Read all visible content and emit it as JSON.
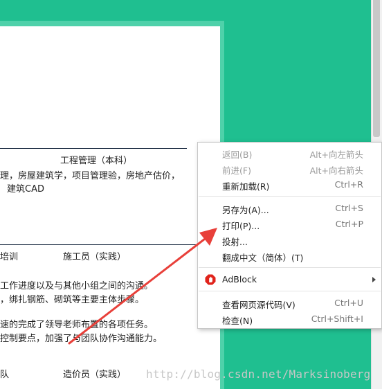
{
  "document": {
    "section_title": "工程管理（本科）",
    "course_line": "理，房屋建筑学，项目管理验，房地产估价，",
    "course_line2": "建筑CAD",
    "training_left": "培训",
    "training_right": "施工员（实践）",
    "para1": "工作进度以及与其他小组之间的沟通。",
    "para2": "，绑扎钢筋、砌筑等主要主体步骤。",
    "para3": "速的完成了领导老师布置的各项任务。",
    "para4": "控制要点，加强了与团队协作沟通能力。",
    "team_left": "队",
    "team_right": "造价员（实践）"
  },
  "context_menu": {
    "items": [
      {
        "label": "返回(B)",
        "shortcut": "Alt+向左箭头",
        "enabled": false
      },
      {
        "label": "前进(F)",
        "shortcut": "Alt+向右箭头",
        "enabled": false
      },
      {
        "label": "重新加载(R)",
        "shortcut": "Ctrl+R",
        "enabled": true
      },
      {
        "label": "另存为(A)...",
        "shortcut": "Ctrl+S",
        "enabled": true
      },
      {
        "label": "打印(P)...",
        "shortcut": "Ctrl+P",
        "enabled": true
      },
      {
        "label": "投射...",
        "shortcut": "",
        "enabled": true
      },
      {
        "label": "翻成中文（简体）(T)",
        "shortcut": "",
        "enabled": true
      },
      {
        "label": "AdBlock",
        "shortcut": "",
        "enabled": true,
        "icon": "adblock-icon",
        "submenu": true
      },
      {
        "label": "查看网页源代码(V)",
        "shortcut": "Ctrl+U",
        "enabled": true
      },
      {
        "label": "检查(N)",
        "shortcut": "Ctrl+Shift+I",
        "enabled": true
      }
    ]
  },
  "watermark": "http://blog.csdn.net/Marksinoberg",
  "colors": {
    "background": "#1fbf90",
    "annotation_arrow": "#e8403a",
    "adblock_red": "#e0231b"
  }
}
